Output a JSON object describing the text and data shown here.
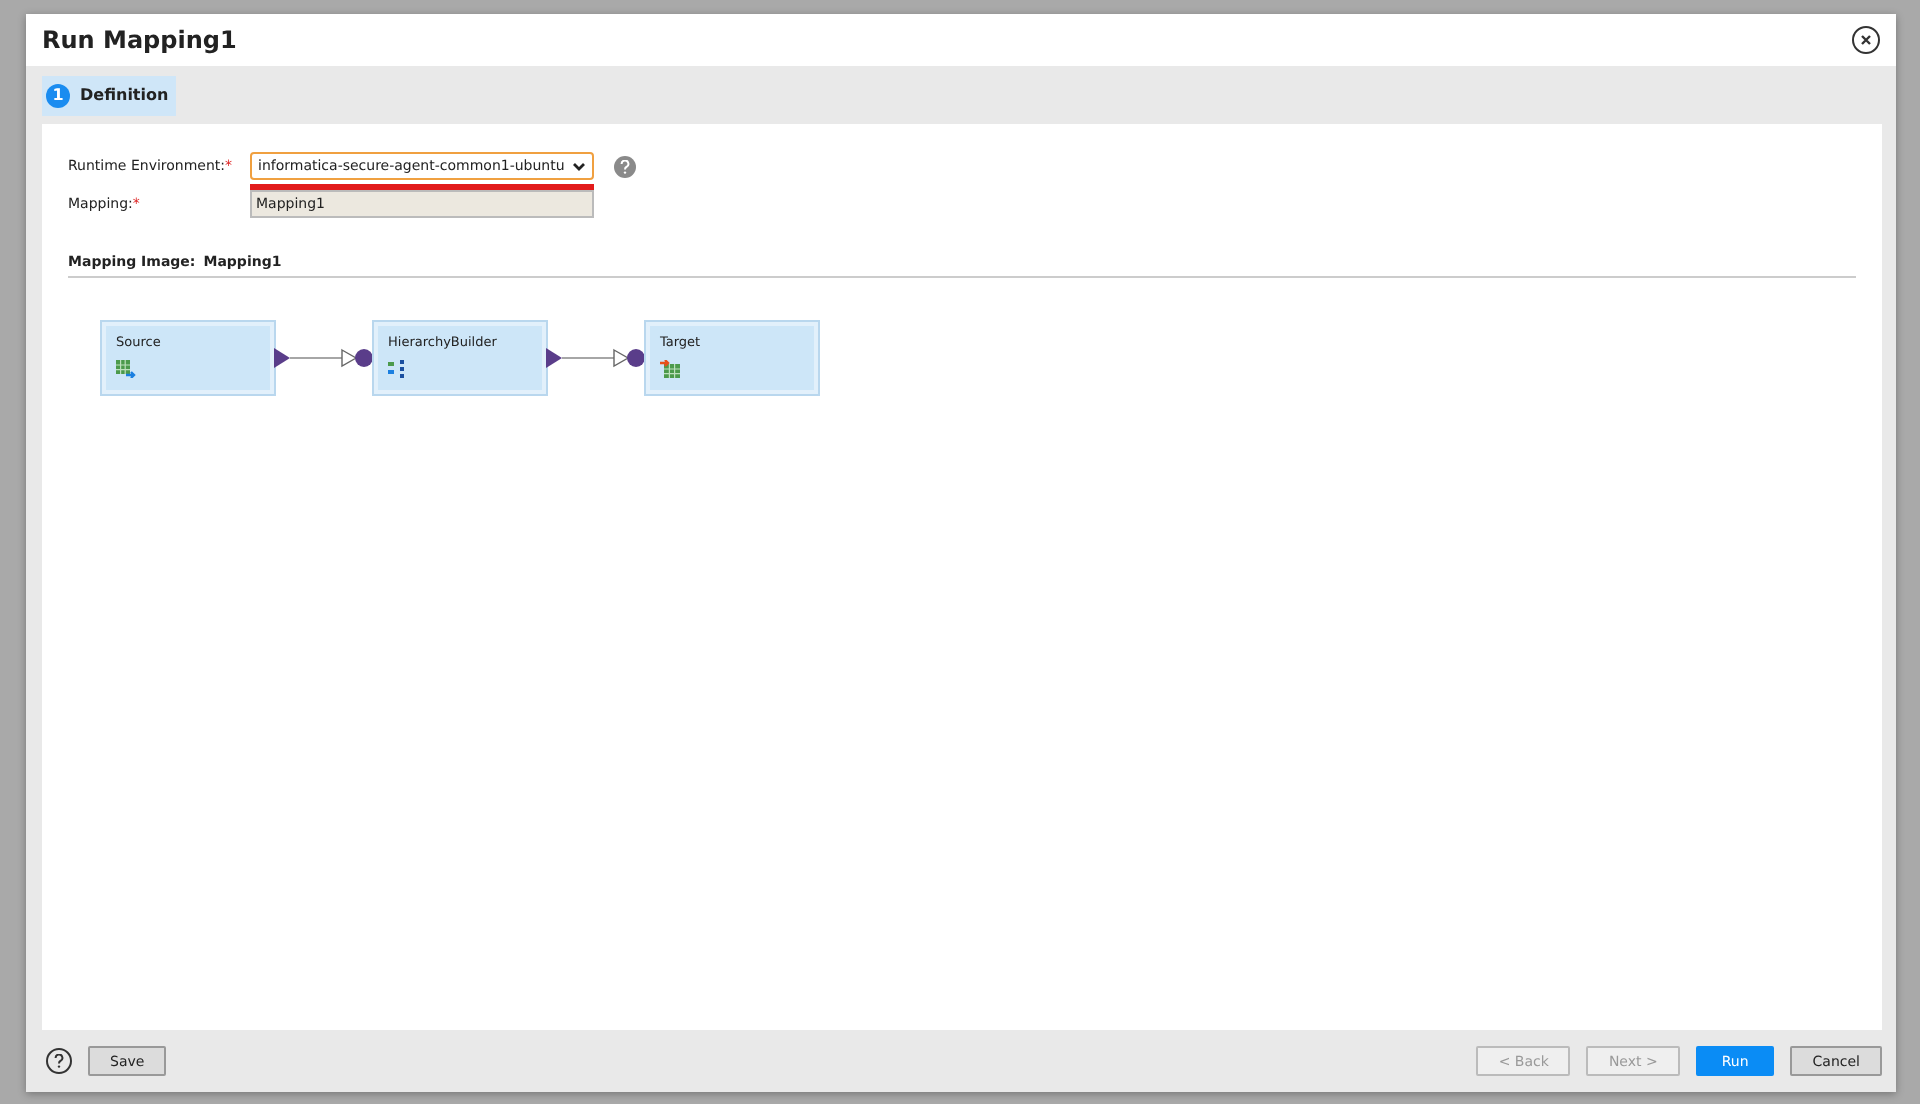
{
  "dialog": {
    "title": "Run Mapping1"
  },
  "steps": [
    {
      "number": "1",
      "label": "Definition",
      "selected": true
    }
  ],
  "form": {
    "fields": [
      {
        "label": "Runtime Environment:",
        "required": "*",
        "kind": "select",
        "value": "informatica-secure-agent-common1-ubuntu",
        "error": true,
        "help": true
      },
      {
        "label": "Mapping:",
        "required": "*",
        "kind": "readonly",
        "value": "Mapping1",
        "error": false,
        "help": false
      }
    ]
  },
  "mapping_image": {
    "heading": "Mapping Image:",
    "name": "Mapping1",
    "nodes": [
      {
        "label": "Source",
        "kind": "source"
      },
      {
        "label": "HierarchyBuilder",
        "kind": "transform"
      },
      {
        "label": "Target",
        "kind": "target"
      }
    ]
  },
  "footer": {
    "save": "Save",
    "buttons": [
      {
        "label": "< Back",
        "kind": "secondary",
        "disabled": true
      },
      {
        "label": "Next >",
        "kind": "secondary",
        "disabled": true
      },
      {
        "label": "Run",
        "kind": "primary",
        "disabled": false
      },
      {
        "label": "Cancel",
        "kind": "secondary",
        "disabled": false
      }
    ]
  }
}
